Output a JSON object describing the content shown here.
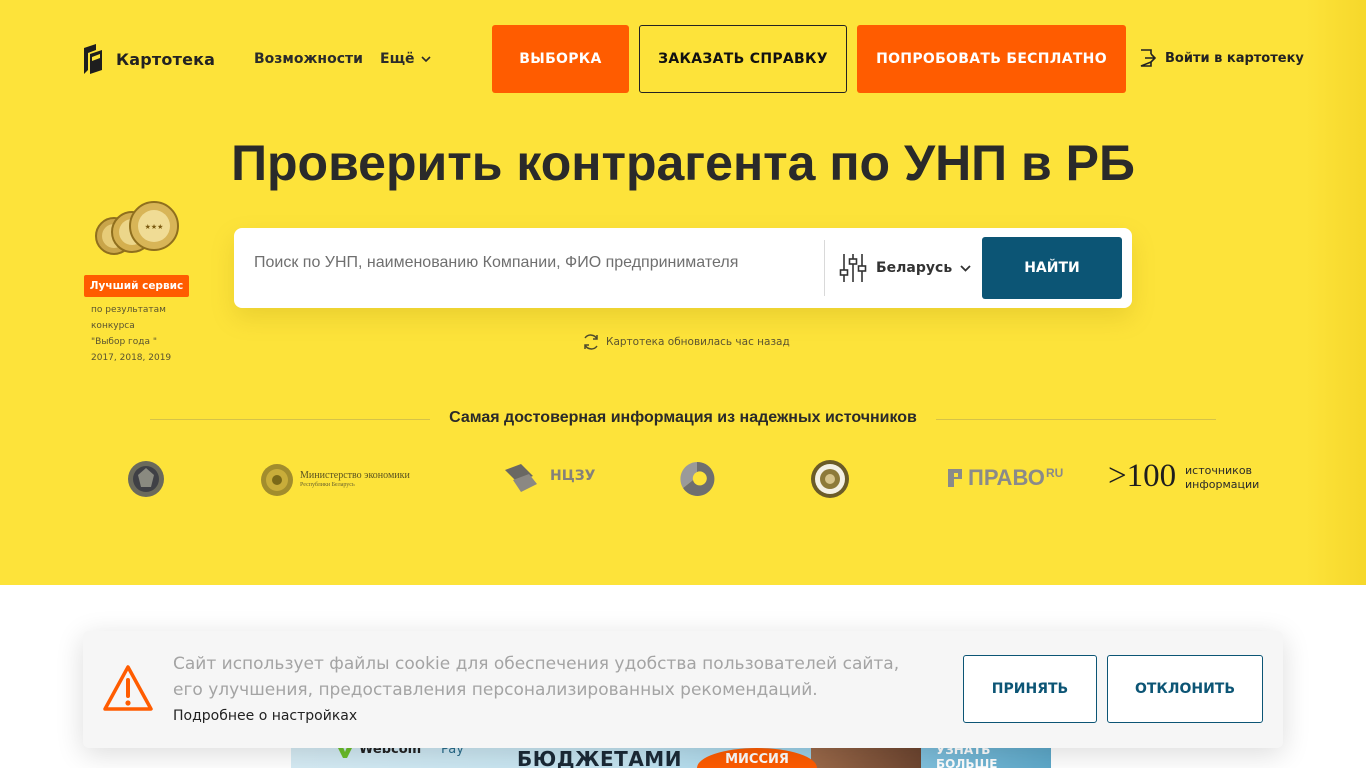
{
  "brand": {
    "name": "Картотека"
  },
  "nav": {
    "features": "Возможности",
    "more": "Ещё"
  },
  "header_buttons": {
    "selection": "ВЫБОРКА",
    "order_report": "ЗАКАЗАТЬ СПРАВКУ",
    "try_free": "ПОПРОБОВАТЬ БЕСПЛАТНО",
    "login": "Войти в картотеку"
  },
  "hero": {
    "title": "Проверить контрагента по УНП в РБ"
  },
  "award": {
    "badge": "Лучший сервис",
    "note_lines": [
      "по результатам",
      "конкурса",
      "\"Выбор года \"",
      "2017, 2018, 2019"
    ]
  },
  "search": {
    "placeholder": "Поиск по УНП, наименованию Компании, ФИО предпринимателя",
    "country": "Беларусь",
    "button": "НАЙТИ",
    "updated": "Картотека обновилась час назад"
  },
  "sources": {
    "title": "Самая достоверная информация из надежных источников",
    "ministry_name": "Министерство экономики",
    "ministry_sub": "Республики Беларусь",
    "ncze": "НЦЗУ",
    "pravo": "ПРАВО",
    "pravo_ru": "RU",
    "count": ">100",
    "count_label_1": "источников",
    "count_label_2": "информации"
  },
  "ad": {
    "brand": "Webcom",
    "pay": "Pay",
    "headline": "БЮДЖЕТАМИ",
    "commission": "МИССИЯ",
    "cta": "УЗНАТЬ БОЛЬШЕ"
  },
  "cookie": {
    "text": "Сайт использует файлы cookie для обеспечения удобства пользователей сайта, его улучшения, предоставления персонализированных рекомендаций.",
    "more": "Подробнее о настройках",
    "accept": "ПРИНЯТЬ",
    "decline": "ОТКЛОНИТЬ"
  },
  "colors": {
    "hero_bg": "#fde33a",
    "accent_orange": "#ff5c00",
    "primary_blue": "#0c5575"
  }
}
